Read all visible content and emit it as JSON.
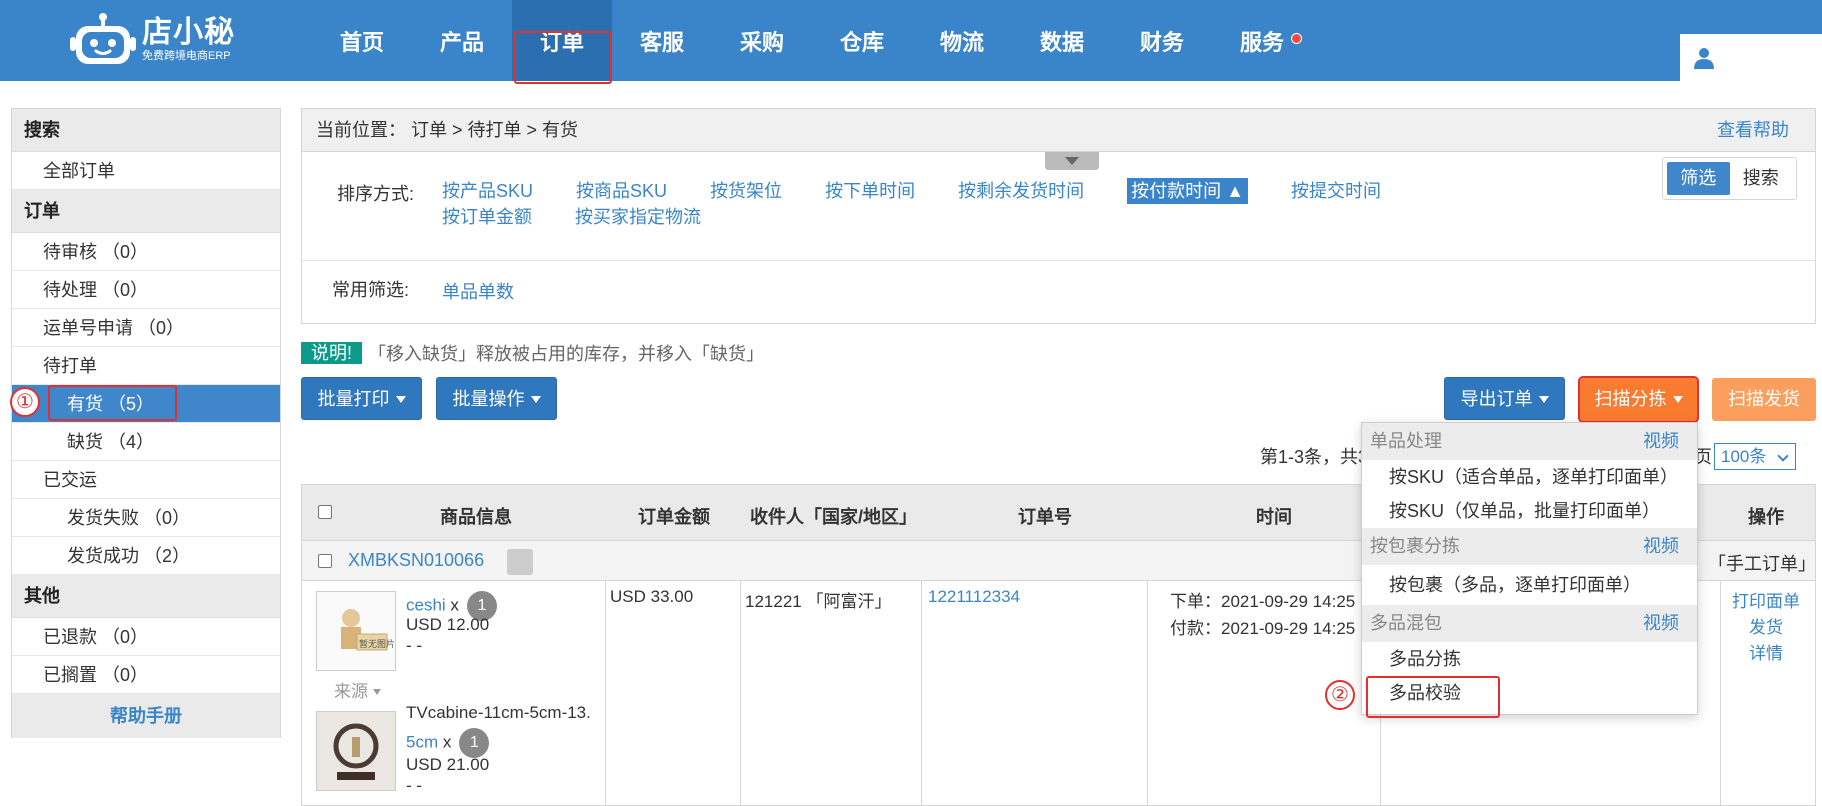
{
  "header": {
    "logo_title": "店小秘",
    "logo_sub": "免费跨境电商ERP",
    "nav": [
      "首页",
      "产品",
      "订单",
      "客服",
      "采购",
      "仓库",
      "物流",
      "数据",
      "财务",
      "服务"
    ],
    "active_nav": "订单"
  },
  "sidebar": {
    "search_head": "搜索",
    "all_orders": "全部订单",
    "orders_head": "订单",
    "pending_review": "待审核 （0）",
    "pending_process": "待处理 （0）",
    "waybill_apply": "运单号申请 （0）",
    "to_print": "待打单",
    "in_stock": "有货 （5）",
    "out_stock": "缺货 （4）",
    "shipped": "已交运",
    "ship_fail": "发货失败 （0）",
    "ship_success": "发货成功 （2）",
    "other_head": "其他",
    "refunded": "已退款 （0）",
    "on_hold": "已搁置 （0）",
    "help": "帮助手册"
  },
  "markers": {
    "one": "①",
    "two": "②"
  },
  "breadcrumb": {
    "label": "当前位置：",
    "path": "订单 > 待打单 > 有货",
    "help": "查看帮助"
  },
  "filter": {
    "sort_label": "排序方式:",
    "sort_options": [
      "按产品SKU",
      "按商品SKU",
      "按货架位",
      "按下单时间",
      "按剩余发货时间",
      "按付款时间 ▲",
      "按提交时间",
      "按订单金额",
      "按买家指定物流"
    ],
    "toggle_filter": "筛选",
    "toggle_search": "搜索",
    "common_label": "常用筛选:",
    "common_link": "单品单数"
  },
  "notice": {
    "tag": "说明!",
    "text": "「移入缺货」释放被占用的库存，并移入「缺货」"
  },
  "toolbar": {
    "batch_print": "批量打印",
    "batch_ops": "批量操作",
    "export": "导出订单",
    "scan_sort": "扫描分拣",
    "scan_ship": "扫描发货"
  },
  "pager": {
    "text": "第1-3条，共3",
    "tail": "页",
    "size": "100条"
  },
  "table": {
    "headers": {
      "product": "商品信息",
      "amount": "订单金额",
      "recipient": "收件人「国家/地区」",
      "order_no": "订单号",
      "time": "时间",
      "action": "操作"
    },
    "group_id": "XMBKSN010066",
    "manual": "「手工订单」",
    "row": {
      "item1_name": "ceshi",
      "item1_x": "x",
      "item1_qty": "1",
      "item1_price": "USD 12.00",
      "item1_dash": "- -",
      "thumb_text": "暂无图片",
      "source": "来源",
      "item2_name1": "TVcabine-11cm-5cm-13.",
      "item2_name2": "5cm",
      "item2_x": "x",
      "item2_qty": "1",
      "item2_price": "USD 21.00",
      "item2_dash": "- -",
      "amount": "USD 33.00",
      "recipient": "121221 「阿富汗」",
      "order_no": "1221112334",
      "time_order": "下单：2021-09-29 14:25",
      "time_pay": "付款：2021-09-29 14:25",
      "act_print": "打印面单",
      "act_ship": "发货",
      "act_detail": "详情"
    }
  },
  "dropdown": {
    "sec1": "单品处理",
    "sec1_vid": "视频",
    "sec1_a": "按SKU（适合单品，逐单打印面单）",
    "sec1_b": "按SKU（仅单品，批量打印面单）",
    "sec2": "按包裹分拣",
    "sec2_vid": "视频",
    "sec2_a": "按包裹（多品，逐单打印面单）",
    "sec3": "多品混包",
    "sec3_vid": "视频",
    "sec3_a": "多品分拣",
    "sec3_b": "多品校验"
  }
}
